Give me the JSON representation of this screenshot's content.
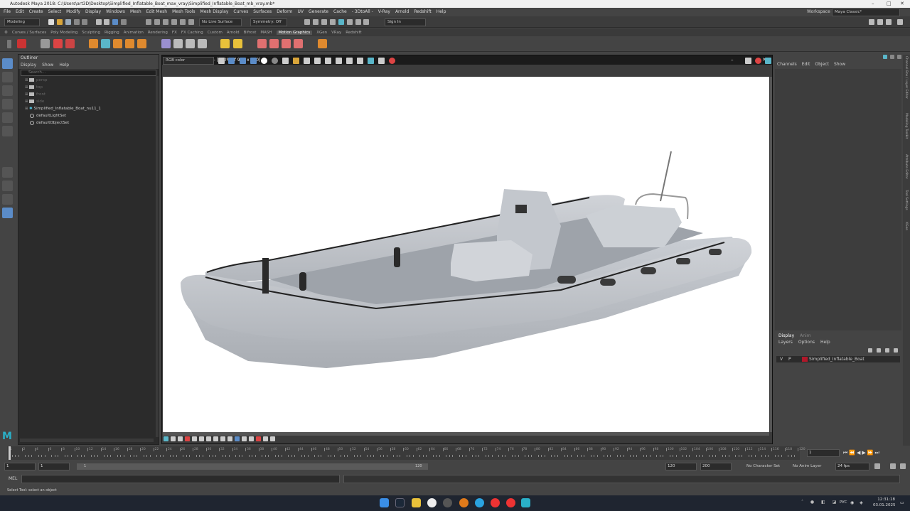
{
  "title": "Autodesk Maya 2018: C:\\Users\\art3D\\Desktop\\Simplified_Inflatable_Boat_max_vray\\Simplified_Inflatable_Boat_mb_vray.mb*",
  "menu": [
    "File",
    "Edit",
    "Create",
    "Select",
    "Modify",
    "Display",
    "Windows",
    "Mesh",
    "Edit Mesh",
    "Mesh Tools",
    "Mesh Display",
    "Curves",
    "Surfaces",
    "Deform",
    "UV",
    "Generate",
    "Cache",
    "- 3DtoAll -",
    "V-Ray",
    "Arnold",
    "Redshift",
    "Help"
  ],
  "workspace": {
    "label": "Workspace :",
    "value": "Maya Classic*"
  },
  "status": {
    "mode": "Modeling",
    "live_surface": "No Live Surface",
    "symmetry": "Symmetry: Off",
    "sign_in": "Sign In"
  },
  "shelf_tabs": [
    "Curves / Surfaces",
    "Poly Modeling",
    "Sculpting",
    "Rigging",
    "Animation",
    "Rendering",
    "FX",
    "FX Caching",
    "Custom",
    "Arnold",
    "Bifrost",
    "MASH",
    "Motion Graphics",
    "XGen",
    "VRay",
    "Redshift"
  ],
  "shelf_active": "Motion Graphics",
  "outliner": {
    "title": "Outliner",
    "menu": [
      "Display",
      "Show",
      "Help"
    ],
    "search_placeholder": "Search...",
    "items": [
      {
        "label": "persp",
        "kind": "camera",
        "dim": true
      },
      {
        "label": "top",
        "kind": "camera",
        "dim": true
      },
      {
        "label": "front",
        "kind": "camera",
        "dim": true
      },
      {
        "label": "side",
        "kind": "camera",
        "dim": true
      },
      {
        "label": "Simplified_Inflatable_Boat_nu11_1",
        "kind": "group",
        "dim": false
      },
      {
        "label": "defaultLightSet",
        "kind": "set",
        "dim": false
      },
      {
        "label": "defaultObjectSet",
        "kind": "set",
        "dim": false
      }
    ]
  },
  "vfb": {
    "title": "V-Ray frame buffer - [200% of 960 x 540]",
    "channel": "RGB color"
  },
  "channelbox": {
    "menu": [
      "Channels",
      "Edit",
      "Object",
      "Show"
    ]
  },
  "layers": {
    "tabs": [
      "Display",
      "Anim"
    ],
    "menu": [
      "Layers",
      "Options",
      "Help"
    ],
    "layer": {
      "v": "V",
      "p": "P",
      "name": "Simplified_Inflatable_Boat",
      "color": "#b0182a"
    }
  },
  "side_tabs": [
    "Channel Box / Layer Editor",
    "Modeling Toolkit",
    "Attribute Editor",
    "Tool Settings",
    "XGen"
  ],
  "timeline": {
    "ticks": [
      "1",
      "2",
      "4",
      "6",
      "8",
      "10",
      "12",
      "14",
      "16",
      "18",
      "20",
      "22",
      "24",
      "26",
      "28",
      "30",
      "32",
      "34",
      "36",
      "38",
      "40",
      "42",
      "44",
      "46",
      "48",
      "50",
      "52",
      "54",
      "56",
      "58",
      "60",
      "62",
      "64",
      "66",
      "68",
      "70",
      "72",
      "74",
      "76",
      "78",
      "80",
      "82",
      "84",
      "86",
      "88",
      "90",
      "92",
      "94",
      "96",
      "98",
      "100",
      "102",
      "104",
      "106",
      "108",
      "110",
      "112",
      "114",
      "116",
      "118",
      "120"
    ],
    "current_frame": "1"
  },
  "range": {
    "start": "1",
    "start2": "1",
    "range_start_label": "1",
    "range_end_label": "120",
    "end": "120",
    "end2": "200",
    "character_set": "No Character Set",
    "anim_layer": "No Anim Layer",
    "fps": "24 fps"
  },
  "cmdline": {
    "label": "MEL"
  },
  "helpline": "Select Tool: select an object",
  "taskbar": {
    "lang": "РУС",
    "time": "12:31:18",
    "date": "03.01.2025"
  }
}
